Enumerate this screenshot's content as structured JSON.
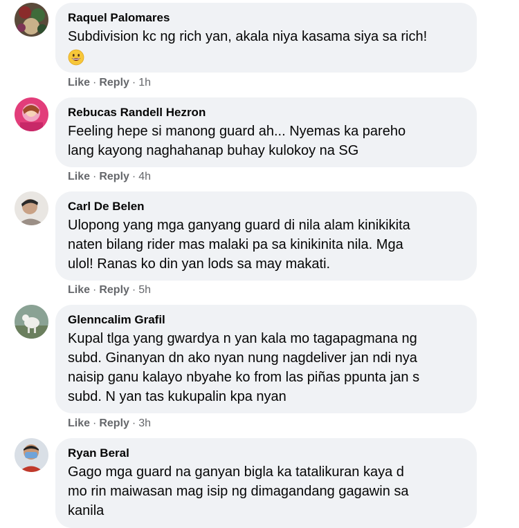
{
  "actions": {
    "like_label": "Like",
    "reply_label": "Reply",
    "separator": "·"
  },
  "comments": [
    {
      "author": "Raquel Palomares",
      "text": "Subdivision kc ng rich yan, akala niya kasama siya sa rich!",
      "emoji": "grinning-face-icon",
      "time": "1h"
    },
    {
      "author": "Rebucas Randell Hezron",
      "text": "Feeling hepe si manong guard ah... Nyemas ka pareho\nlang kayong naghahanap buhay kulokoy na SG",
      "time": "4h"
    },
    {
      "author": "Carl De Belen",
      "text": "Ulopong yang mga ganyang guard di nila alam kinikikita\nnaten bilang rider mas malaki pa sa kinikinita nila. Mga\nulol! Ranas ko din yan lods sa may makati.",
      "time": "5h"
    },
    {
      "author": "Glenncalim Grafil",
      "text": "Kupal tlga yang gwardya n yan kala mo tagapagmana ng\nsubd. Ginanyan dn ako nyan nung nagdeliver jan ndi nya\nnaisip ganu kalayo nbyahe ko from las piñas ppunta jan s\nsubd. N yan tas kukupalin kpa nyan",
      "time": "3h"
    },
    {
      "author": "Ryan Beral",
      "text": "Gago mga guard na ganyan bigla ka tatalikuran kaya d\nmo rin maiwasan mag isip ng dimagandang gagawin sa\nkanila"
    }
  ]
}
